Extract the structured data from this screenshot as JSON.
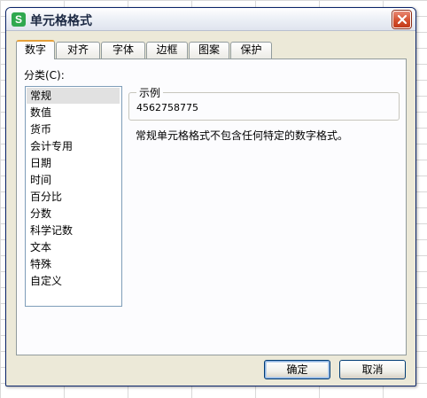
{
  "dialog": {
    "title": "单元格格式",
    "app_icon_letter": "S",
    "app_icon_color": "#2fa84f"
  },
  "tabs": [
    {
      "label": "数字",
      "active": true
    },
    {
      "label": "对齐",
      "active": false
    },
    {
      "label": "字体",
      "active": false
    },
    {
      "label": "边框",
      "active": false
    },
    {
      "label": "图案",
      "active": false
    },
    {
      "label": "保护",
      "active": false
    }
  ],
  "category": {
    "label": "分类(C):",
    "items": [
      "常规",
      "数值",
      "货币",
      "会计专用",
      "日期",
      "时间",
      "百分比",
      "分数",
      "科学记数",
      "文本",
      "特殊",
      "自定义"
    ],
    "selected": "常规"
  },
  "sample": {
    "legend": "示例",
    "value": "4562758775"
  },
  "description": "常规单元格格式不包含任何特定的数字格式。",
  "buttons": {
    "ok": "确定",
    "cancel": "取消"
  }
}
